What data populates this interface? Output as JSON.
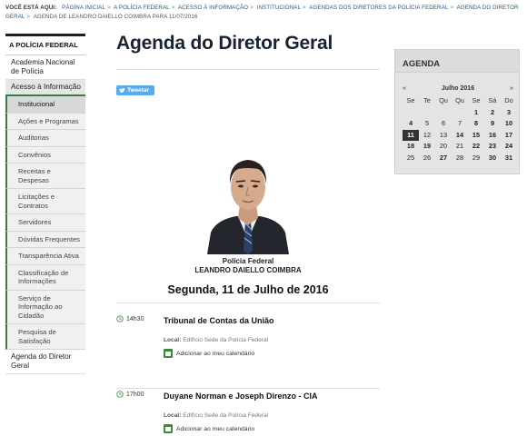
{
  "breadcrumb": {
    "label": "VOCÊ ESTÁ AQUI:",
    "items": [
      "PÁGINA INICIAL",
      "A POLÍCIA FEDERAL",
      "ACESSO À INFORMAÇÃO",
      "INSTITUCIONAL",
      "AGENDAS DOS DIRETORES DA POLÍCIA FEDERAL",
      "AGENDA DO DIRETOR GERAL"
    ],
    "current": "AGENDA DE LEANDRO DAIELLO COIMBRA PARA 11/07/2016"
  },
  "sidebar": {
    "title": "A POLÍCIA FEDERAL",
    "items": [
      {
        "label": "Academia Nacional de Polícia"
      },
      {
        "label": "Acesso à Informação"
      }
    ],
    "subitems": [
      {
        "label": "Institucional"
      },
      {
        "label": "Ações e Programas"
      },
      {
        "label": "Auditorias"
      },
      {
        "label": "Convênios"
      },
      {
        "label": "Receitas e Despesas"
      },
      {
        "label": "Licitações e Contratos"
      },
      {
        "label": "Servidores"
      },
      {
        "label": "Dúvidas Frequentes"
      },
      {
        "label": "Transparência Ativa"
      },
      {
        "label": "Classificação de Informações"
      },
      {
        "label": "Serviço de Informação ao Cidadão"
      },
      {
        "label": "Pesquisa de Satisfação"
      }
    ],
    "bottom_item": "Agenda do Diretor Geral"
  },
  "page": {
    "title": "Agenda do Diretor Geral",
    "tweet_label": "Tweetar",
    "org": "Polícia Federal",
    "person": "LEANDRO DAIELLO COIMBRA",
    "date": "Segunda, 11 de Julho de 2016"
  },
  "events": [
    {
      "time": "14h30",
      "title": "Tribunal de Contas da União",
      "local_label": "Local:",
      "local": "Edifício Sede da Polícia Federal",
      "calendar_label": "Adicionar ao meu calendário"
    },
    {
      "time": "17h00",
      "title": "Duyane Norman e Joseph Direnzo - CIA",
      "local_label": "Local:",
      "local": "Edifício Sede da Polícia Federal",
      "calendar_label": "Adicionar ao meu calendário"
    }
  ],
  "calendar": {
    "title": "AGENDA",
    "prev": "«",
    "next": "»",
    "month": "Julho 2016",
    "weekdays": [
      "Se",
      "Te",
      "Qu",
      "Qu",
      "Se",
      "Sá",
      "Do"
    ],
    "weeks": [
      [
        "",
        "",
        "",
        "",
        "1",
        "2",
        "3"
      ],
      [
        "4",
        "5",
        "6",
        "7",
        "8",
        "9",
        "10"
      ],
      [
        "11",
        "12",
        "13",
        "14",
        "15",
        "16",
        "17"
      ],
      [
        "18",
        "19",
        "20",
        "21",
        "22",
        "23",
        "24"
      ],
      [
        "25",
        "26",
        "27",
        "28",
        "29",
        "30",
        "31"
      ]
    ],
    "selected_day": "11",
    "bold_days": [
      "1",
      "2",
      "3",
      "4",
      "8",
      "9",
      "10",
      "11",
      "14",
      "15",
      "16",
      "17",
      "18",
      "19",
      "22",
      "23",
      "24",
      "27",
      "30",
      "31"
    ]
  }
}
